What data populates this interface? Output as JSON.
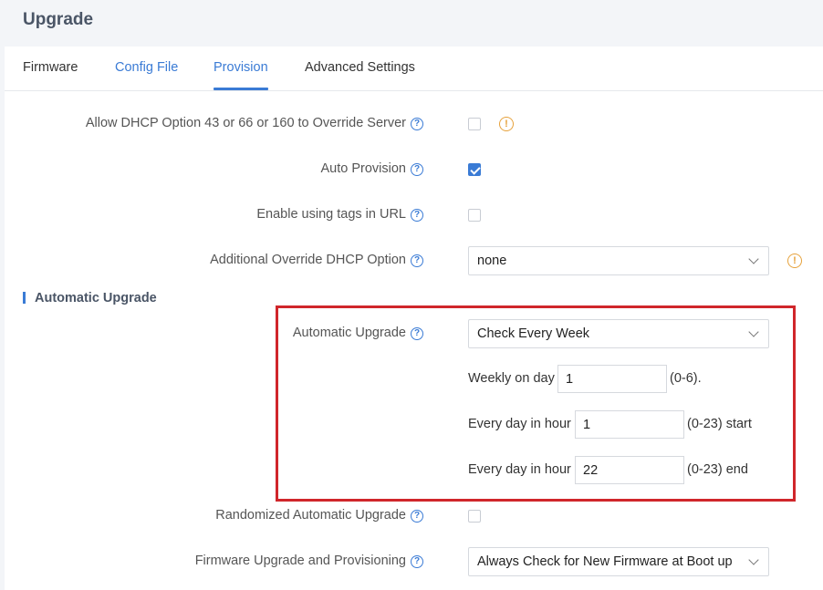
{
  "page": {
    "title": "Upgrade"
  },
  "tabs": [
    {
      "label": "Firmware"
    },
    {
      "label": "Config File"
    },
    {
      "label": "Provision"
    },
    {
      "label": "Advanced Settings"
    }
  ],
  "rows": {
    "dhcp_override": {
      "label": "Allow DHCP Option 43 or 66 or 160 to Override Server",
      "checked": false
    },
    "auto_provision": {
      "label": "Auto Provision",
      "checked": true
    },
    "tags_in_url": {
      "label": "Enable using tags in URL",
      "checked": false
    },
    "additional_dhcp": {
      "label": "Additional Override DHCP Option",
      "value": "none"
    }
  },
  "section": {
    "title": "Automatic Upgrade"
  },
  "auto_upgrade": {
    "label": "Automatic Upgrade",
    "value": "Check Every Week",
    "weekly_label": "Weekly on day",
    "weekly_value": "1",
    "weekly_range": "(0-6).",
    "hour_label_start": "Every day in hour",
    "hour_start_value": "1",
    "hour_start_range": "(0-23) start",
    "hour_label_end": "Every day in hour",
    "hour_end_value": "22",
    "hour_end_range": "(0-23) end"
  },
  "randomized": {
    "label": "Randomized Automatic Upgrade",
    "checked": false
  },
  "firmware_prov": {
    "label": "Firmware Upgrade and Provisioning",
    "value": "Always Check for New Firmware at Boot up"
  },
  "icons": {
    "help": "?",
    "warn": "!"
  },
  "colors": {
    "accent": "#3a7bd5",
    "highlight_box": "#d0262b",
    "warning": "#e6a23c"
  }
}
